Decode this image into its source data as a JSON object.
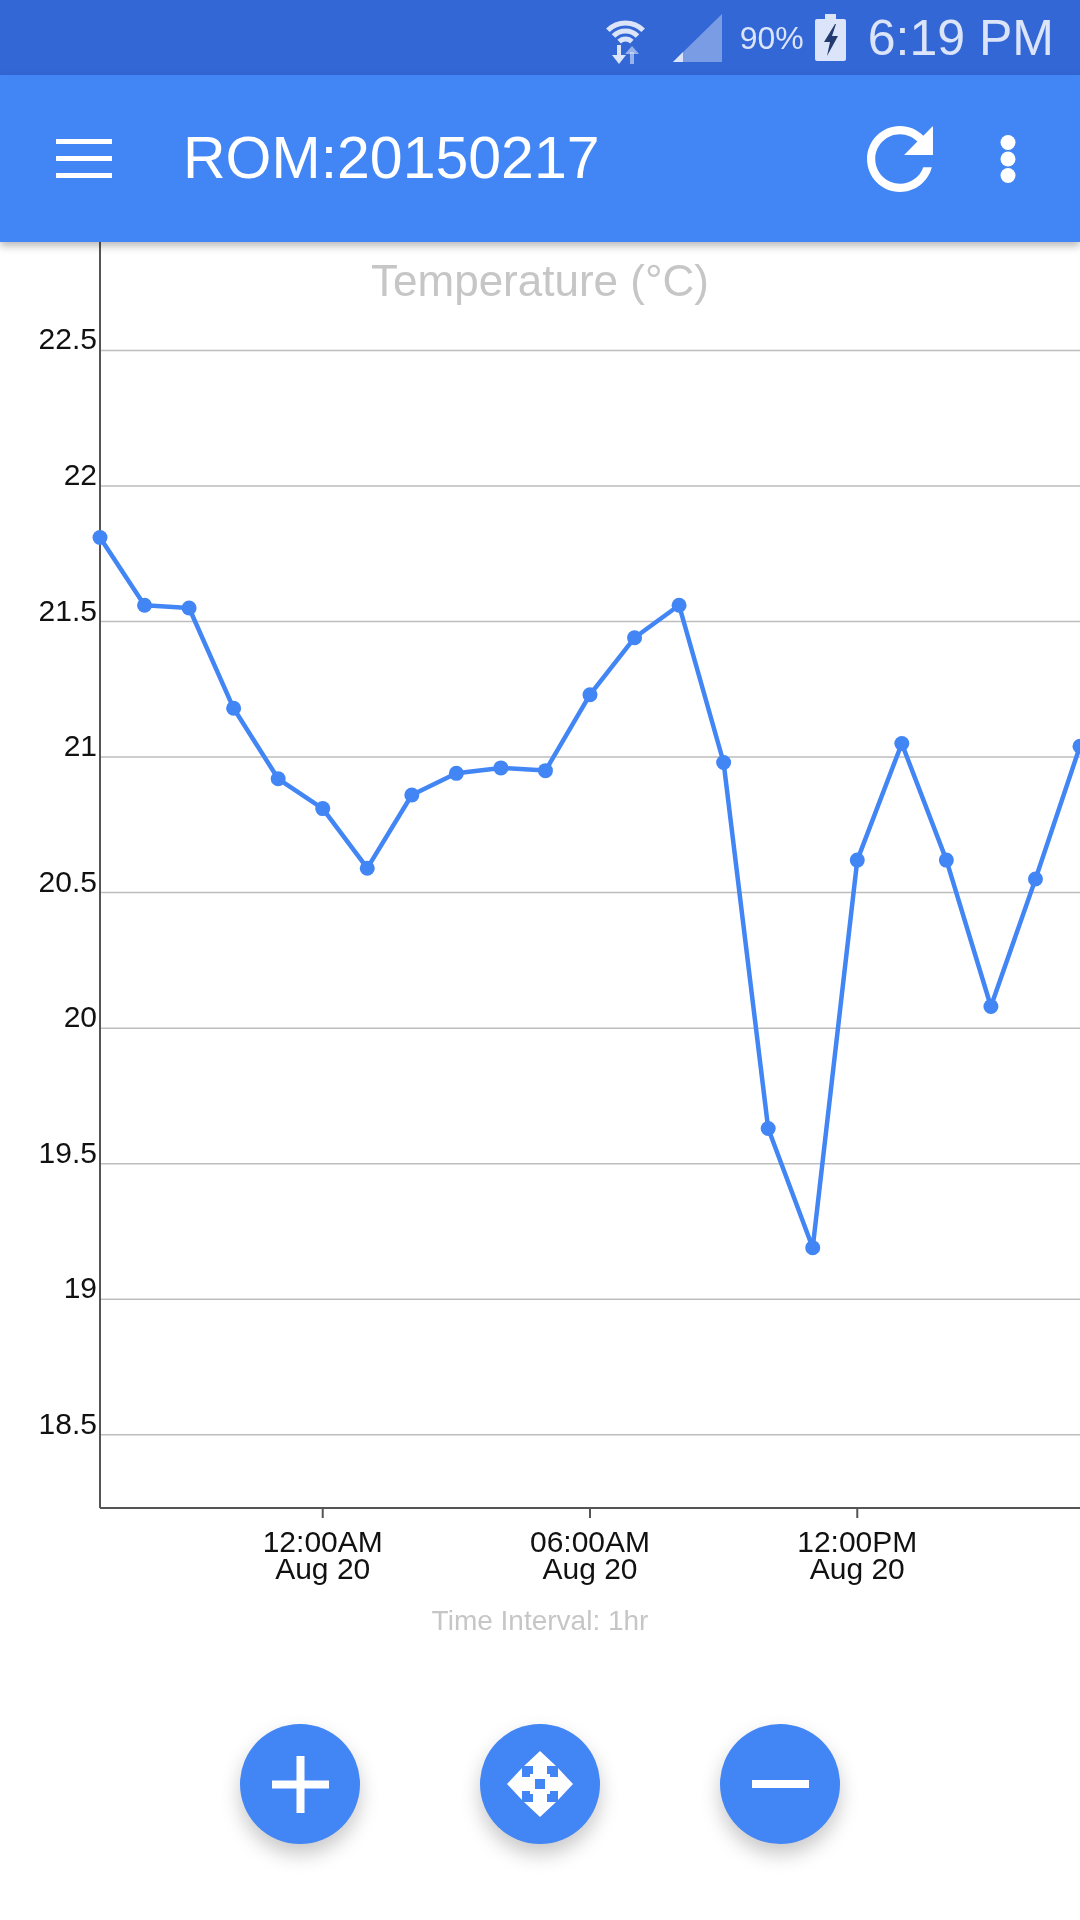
{
  "status_bar": {
    "battery": "90%",
    "time": "6:19 PM"
  },
  "app_bar": {
    "title": "ROM:20150217"
  },
  "chart": {
    "chart_data": {
      "type": "line",
      "title": "Temperature (°C)",
      "xlabel": "Time Interval: 1hr",
      "categories": [
        null,
        null,
        null,
        null,
        null,
        "12:00AM\nAug 20",
        null,
        null,
        null,
        null,
        null,
        "06:00AM\nAug 20",
        null,
        null,
        null,
        null,
        null,
        "12:00PM\nAug 20",
        null,
        null,
        null,
        null,
        null
      ],
      "series": [
        {
          "color": "#4285f4",
          "marker": "circle",
          "values": [
            21.81,
            21.56,
            21.55,
            21.18,
            20.92,
            20.81,
            20.59,
            20.86,
            20.94,
            20.96,
            20.95,
            21.23,
            21.44,
            21.56,
            20.98,
            19.63,
            19.19,
            20.62,
            21.05,
            20.62,
            20.08,
            20.55,
            21.04
          ]
        }
      ],
      "ylim": [
        18.23,
        22.9
      ],
      "yticks": [
        18.5,
        19,
        19.5,
        20,
        20.5,
        21,
        21.5,
        22,
        22.5
      ],
      "grid": true
    }
  },
  "controls": [
    {
      "kind": "zoom_in"
    },
    {
      "kind": "pan"
    },
    {
      "kind": "zoom_out"
    }
  ]
}
